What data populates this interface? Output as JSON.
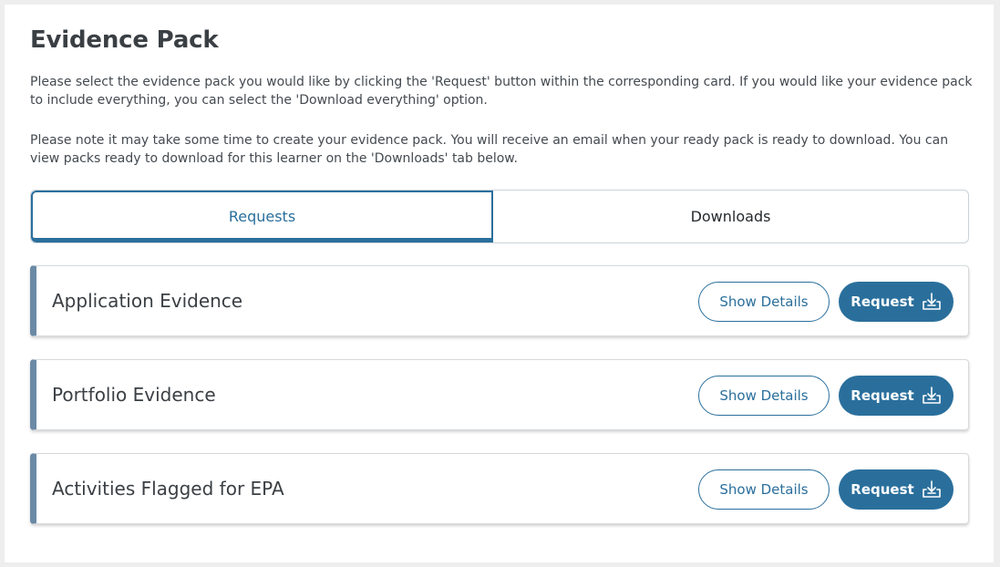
{
  "page": {
    "title": "Evidence Pack",
    "intro_1": "Please select the evidence pack you would like by clicking the 'Request' button within the corresponding card. If you would like your evidence pack to include everything, you can select the 'Download everything' option.",
    "intro_2": "Please note it may take some time to create your evidence pack. You will receive an email when your ready pack is ready to download. You can view packs ready to download for this learner on the 'Downloads' tab below."
  },
  "tabs": [
    {
      "label": "Requests",
      "active": true
    },
    {
      "label": "Downloads",
      "active": false
    }
  ],
  "cards": [
    {
      "title": "Application Evidence",
      "details_label": "Show Details",
      "request_label": "Request",
      "request_icon": "download-tray-icon"
    },
    {
      "title": "Portfolio Evidence",
      "details_label": "Show Details",
      "request_label": "Request",
      "request_icon": "download-tray-icon"
    },
    {
      "title": "Activities Flagged for EPA",
      "details_label": "Show Details",
      "request_label": "Request",
      "request_icon": "download-tray-icon"
    }
  ],
  "colors": {
    "accent": "#2a6f9c",
    "card_stripe": "#6b8aa6",
    "background": "#eeeeee"
  }
}
